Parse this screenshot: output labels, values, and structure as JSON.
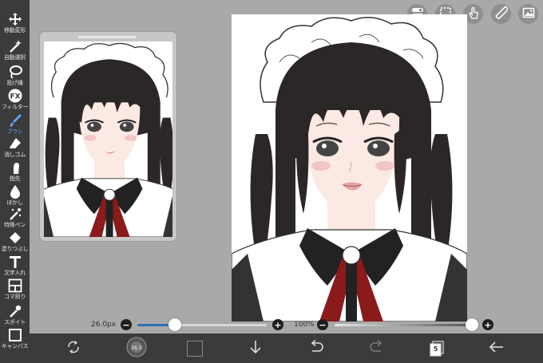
{
  "toolbar": {
    "tools": [
      {
        "label": "移動変形",
        "icon": "move-icon"
      },
      {
        "label": "自動選択",
        "icon": "magic-wand-icon"
      },
      {
        "label": "投げ縄",
        "icon": "lasso-icon"
      },
      {
        "label": "フィルター",
        "icon": "fx-icon"
      },
      {
        "label": "ブラシ",
        "icon": "brush-icon"
      },
      {
        "label": "消しゴム",
        "icon": "eraser-icon"
      },
      {
        "label": "指先",
        "icon": "smudge-icon"
      },
      {
        "label": "ぼかし",
        "icon": "blur-drop-icon"
      },
      {
        "label": "特殊ペン",
        "icon": "special-pen-icon"
      },
      {
        "label": "塗りつぶし",
        "icon": "fill-bucket-icon"
      },
      {
        "label": "文字入れ",
        "icon": "text-icon"
      },
      {
        "label": "コマ割り",
        "icon": "panel-icon"
      },
      {
        "label": "スポイト",
        "icon": "eyedropper-icon"
      },
      {
        "label": "キャンバス",
        "icon": "canvas-icon"
      }
    ],
    "active_tool": "ブラシ",
    "active_color": "#5aa6ff"
  },
  "top_buttons": [
    {
      "icon": "toggle-icon"
    },
    {
      "icon": "selection-icon"
    },
    {
      "icon": "hand-icon"
    },
    {
      "icon": "ruler-icon"
    },
    {
      "icon": "image-icon"
    }
  ],
  "brush_size": {
    "label": "26.0px",
    "minus": "−",
    "plus": "+",
    "fraction": 0.29
  },
  "brush_opacity": {
    "label": "100%",
    "minus": "−",
    "plus": "+",
    "fraction": 1.0
  },
  "bottom_bar": {
    "brush_preview_text": "26.0",
    "current_color": "#3a3a3a",
    "layer_count": "5",
    "items": [
      {
        "icon": "transform-icon"
      },
      {
        "icon": "brush-preview-icon"
      },
      {
        "icon": "color-swatch"
      },
      {
        "icon": "download-arrow-icon"
      },
      {
        "icon": "undo-icon"
      },
      {
        "icon": "redo-icon"
      },
      {
        "icon": "layers-icon"
      },
      {
        "icon": "back-arrow-icon"
      }
    ]
  },
  "colors": {
    "toolbar_bg": "#3b3b3b",
    "workspace_bg": "#a9a9a9",
    "hair": "#2c2727",
    "collar": "#222222",
    "ribbon": "#8b1a1a",
    "skin": "#fbe9e4",
    "slider_fill": "#2f6fb8"
  }
}
